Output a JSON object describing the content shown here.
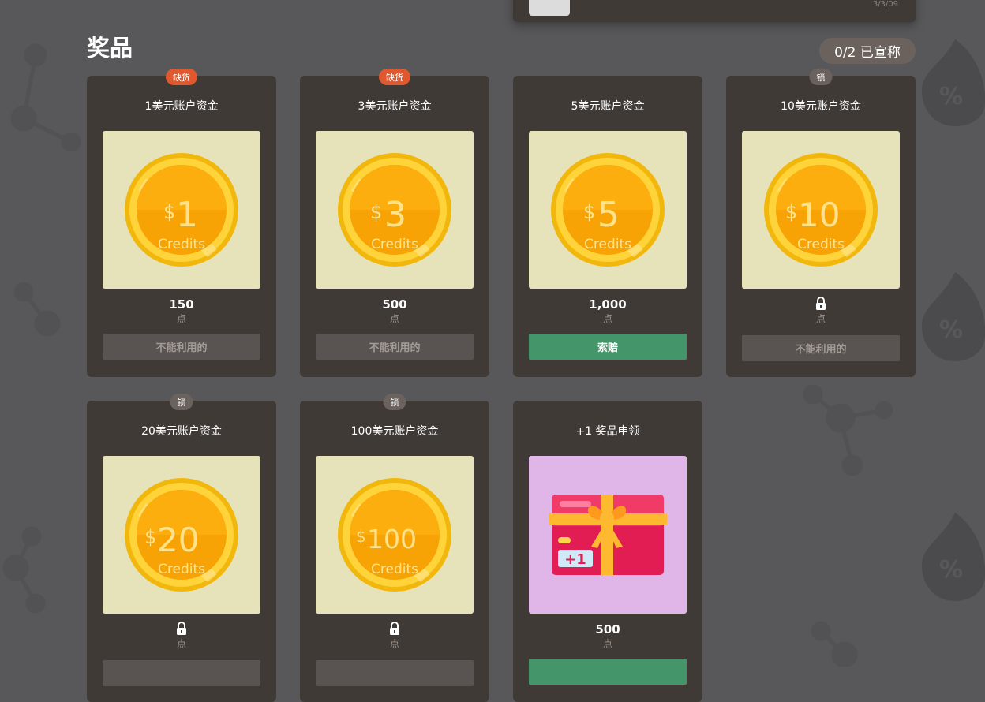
{
  "top_card": {
    "date": "3/3/09"
  },
  "section": {
    "title": "奖品",
    "claimed": "0/2 已宣称"
  },
  "coin_label": "Credits",
  "coin_currency": "$",
  "rewards": [
    {
      "title": "1美元账户资金",
      "badge": "缺货",
      "badge_type": "out",
      "coin_amount": "1",
      "price": "150",
      "unit": "点",
      "action": "不能利用的",
      "action_state": "disabled"
    },
    {
      "title": "3美元账户资金",
      "badge": "缺货",
      "badge_type": "out",
      "coin_amount": "3",
      "price": "500",
      "unit": "点",
      "action": "不能利用的",
      "action_state": "disabled"
    },
    {
      "title": "5美元账户资金",
      "badge": "",
      "badge_type": "",
      "coin_amount": "5",
      "price": "1,000",
      "unit": "点",
      "action": "索赔",
      "action_state": "claim"
    },
    {
      "title": "10美元账户资金",
      "badge": "锁",
      "badge_type": "lock",
      "coin_amount": "10",
      "price": "",
      "unit": "点",
      "action": "不能利用的",
      "action_state": "disabled"
    },
    {
      "title": "20美元账户资金",
      "badge": "锁",
      "badge_type": "lock",
      "coin_amount": "20",
      "price": "",
      "unit": "点",
      "action": "",
      "action_state": "disabled"
    },
    {
      "title": "100美元账户资金",
      "badge": "锁",
      "badge_type": "lock",
      "coin_amount": "100",
      "price": "",
      "unit": "点",
      "action": "",
      "action_state": "disabled"
    },
    {
      "title": "+1 奖品申领",
      "badge": "",
      "badge_type": "",
      "gift_label": "+1",
      "price": "500",
      "unit": "点",
      "action": "",
      "action_state": "claim"
    }
  ],
  "colors": {
    "background": "#58585a",
    "card": "#403a37",
    "claim": "#45956a",
    "out_of_stock": "#e0582d",
    "locked": "#6b625d"
  },
  "icons": {
    "lock": "lock-icon",
    "coin": "coin-icon",
    "gift": "gift-card-icon"
  }
}
